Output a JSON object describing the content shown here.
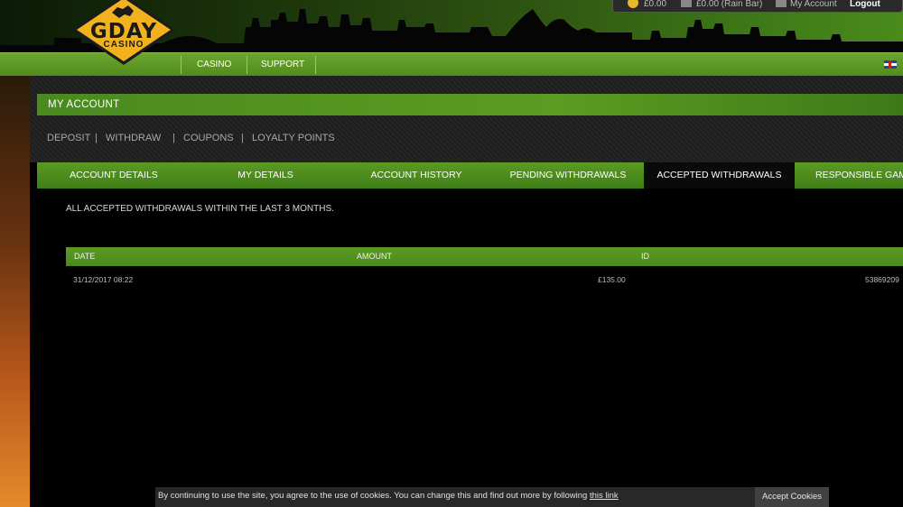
{
  "brand": {
    "line1": "GDAY",
    "line2": "CASINO"
  },
  "topbar": {
    "balance": "£0.00",
    "bonus": "£0.00 (Rain Bar)",
    "my_account": "My Account",
    "logout": "Logout"
  },
  "main_nav": {
    "casino": "CASINO",
    "support": "SUPPORT"
  },
  "account": {
    "title": "MY ACCOUNT"
  },
  "subnav": {
    "deposit": "DEPOSIT",
    "withdraw": "WITHDRAW",
    "coupons": "COUPONS",
    "loyalty": "LOYALTY POINTS",
    "sep": "|"
  },
  "tabs": [
    {
      "label": "ACCOUNT DETAILS"
    },
    {
      "label": "MY DETAILS"
    },
    {
      "label": "ACCOUNT HISTORY"
    },
    {
      "label": "PENDING WITHDRAWALS"
    },
    {
      "label": "ACCEPTED WITHDRAWALS"
    },
    {
      "label": "RESPONSIBLE GAMING"
    }
  ],
  "intro": "ALL ACCEPTED WITHDRAWALS WITHIN THE LAST 3 MONTHS.",
  "table": {
    "headers": [
      "DATE",
      "AMOUNT",
      "ID"
    ],
    "rows": [
      {
        "date": "31/12/2017 08:22",
        "amount": "£135.00",
        "id": "53869209"
      }
    ]
  },
  "cookie": {
    "text": "By continuing to use the site, you agree to the use of cookies. You can change this and find out more by following",
    "link": "this link",
    "button": "Accept Cookies"
  },
  "colors": {
    "accent_green": "#5b9b23",
    "logo_yellow": "#f2b21d",
    "background": "#000000"
  }
}
